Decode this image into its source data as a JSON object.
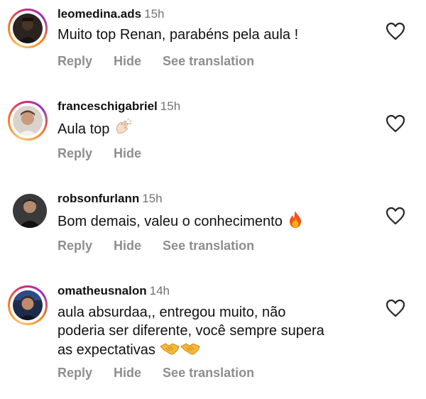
{
  "comments": [
    {
      "username": "leomedina.ads",
      "time": "15h",
      "text": "Muito top Renan, parabéns pela aula !",
      "actions": {
        "reply": "Reply",
        "hide": "Hide",
        "translate": "See translation"
      },
      "story_ring": true
    },
    {
      "username": "franceschigabriel",
      "time": "15h",
      "text": "Aula top",
      "emoji": "clapping-hands",
      "actions": {
        "reply": "Reply",
        "hide": "Hide"
      },
      "story_ring": true
    },
    {
      "username": "robsonfurlann",
      "time": "15h",
      "text": "Bom demais, valeu o conhecimento",
      "emoji": "fire",
      "actions": {
        "reply": "Reply",
        "hide": "Hide",
        "translate": "See translation"
      },
      "story_ring": false
    },
    {
      "username": "omatheusnalon",
      "time": "14h",
      "text_lines": [
        "aula absurdaa,, entregou muito, não",
        "poderia ser diferente, você sempre supera",
        "as expectativas"
      ],
      "emoji": "handshake x2",
      "actions": {
        "reply": "Reply",
        "hide": "Hide",
        "translate": "See translation"
      },
      "story_ring": true
    }
  ],
  "icons": {
    "like": "heart-outline-icon"
  },
  "colors": {
    "username": "#111111",
    "secondary": "#737373",
    "action": "#8e8e8e",
    "ring_start": "#fdc468",
    "ring_mid": "#d62976",
    "ring_end": "#962fbf"
  }
}
